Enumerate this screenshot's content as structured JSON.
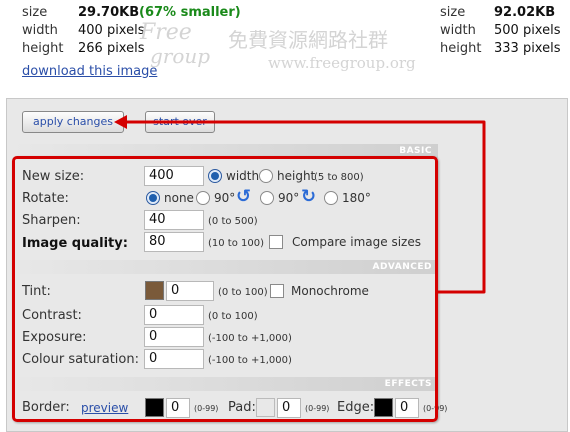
{
  "stats_left": {
    "size_label": "size",
    "size_value": "29.70KB",
    "size_saving": "(67% smaller)",
    "width_label": "width",
    "width_value": "400 pixels",
    "height_label": "height",
    "height_value": "266 pixels",
    "download_label": "download this image"
  },
  "stats_right": {
    "size_label": "size",
    "size_value": "92.02KB",
    "width_label": "width",
    "width_value": "500 pixels",
    "height_label": "height",
    "height_value": "333 pixels"
  },
  "watermark": {
    "logo_text_1": "Free",
    "logo_text_2": "group",
    "chinese_text": "免費資源網路社群",
    "url": "www.freegroup.org"
  },
  "buttons": {
    "apply": "apply changes",
    "start_over": "start over"
  },
  "sections": {
    "basic": "BASIC",
    "advanced": "ADVANCED",
    "effects": "EFFECTS"
  },
  "basic": {
    "new_size_label": "New size:",
    "new_size_value": "400",
    "width_option": "width",
    "height_option": "height",
    "size_range": "(5 to 800)",
    "rotate_label": "Rotate:",
    "rotate_none": "none",
    "rotate_90_left": "90°",
    "rotate_90_right": "90°",
    "rotate_180": "180°",
    "sharpen_label": "Sharpen:",
    "sharpen_value": "40",
    "sharpen_range": "(0 to 500)",
    "quality_label": "Image quality:",
    "quality_value": "80",
    "quality_range": "(10 to 100)",
    "compare_label": "Compare image sizes"
  },
  "advanced": {
    "tint_label": "Tint:",
    "tint_value": "0",
    "tint_range": "(0 to 100)",
    "tint_color": "#7a5a3a",
    "monochrome_label": "Monochrome",
    "contrast_label": "Contrast:",
    "contrast_value": "0",
    "contrast_range": "(0 to 100)",
    "exposure_label": "Exposure:",
    "exposure_value": "0",
    "exposure_range": "(-100 to +1,000)",
    "saturation_label": "Colour saturation:",
    "saturation_value": "0",
    "saturation_range": "(-100 to +1,000)"
  },
  "effects": {
    "border_label": "Border:",
    "preview_link": "preview",
    "border_value": "0",
    "border_range": "(0-99)",
    "border_color": "#000000",
    "pad_label": "Pad:",
    "pad_value": "0",
    "pad_range": "(0-99)",
    "pad_color": "#e8e8e8",
    "edge_label": "Edge:",
    "edge_value": "0",
    "edge_range": "(0-99)",
    "edge_color": "#000000"
  },
  "colors": {
    "accent_red": "#d40000",
    "saving_green": "#1a8a1a",
    "link_blue": "#2a4ea8"
  }
}
